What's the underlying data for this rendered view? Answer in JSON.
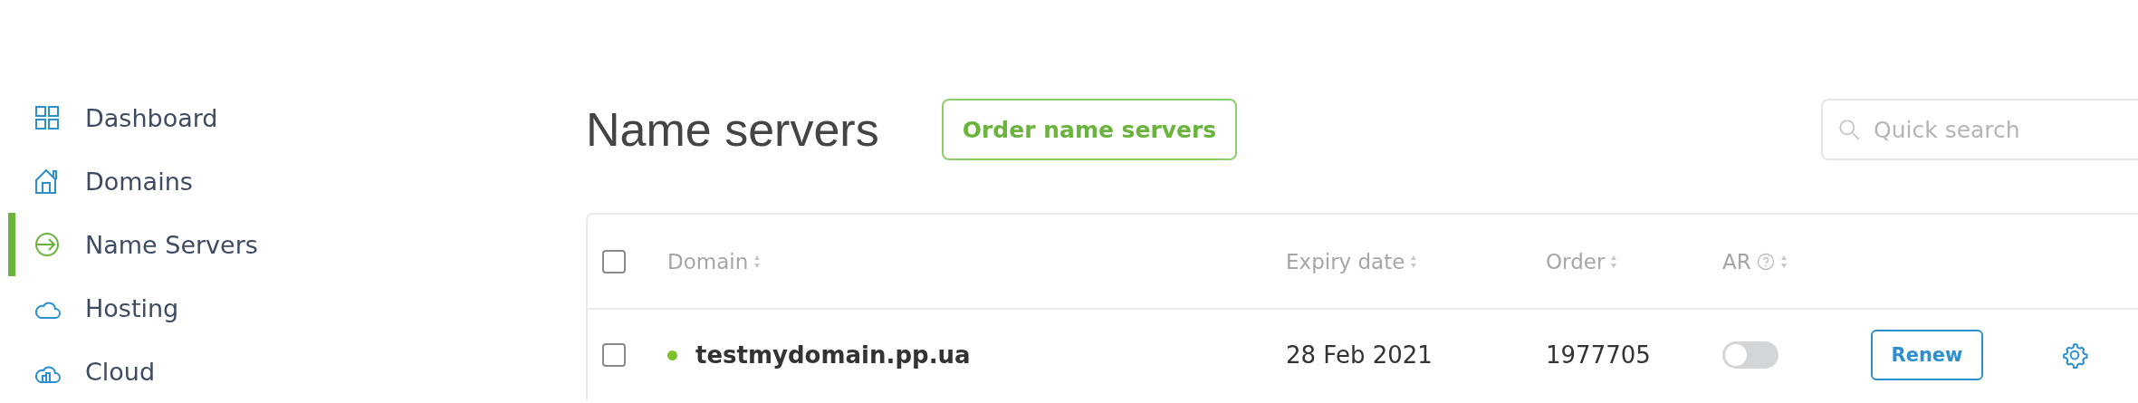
{
  "sidebar": {
    "items": [
      {
        "label": "Dashboard",
        "selected": false
      },
      {
        "label": "Domains",
        "selected": false
      },
      {
        "label": "Name Servers",
        "selected": true
      },
      {
        "label": "Hosting",
        "selected": false
      },
      {
        "label": "Cloud",
        "selected": false
      }
    ]
  },
  "page": {
    "title": "Name servers",
    "order_button": "Order name servers",
    "search": {
      "placeholder": "Quick search"
    }
  },
  "table": {
    "select_all": {
      "checked": false
    },
    "columns": [
      {
        "label": "Domain"
      },
      {
        "label": "Expiry date"
      },
      {
        "label": "Order"
      },
      {
        "label": "AR"
      }
    ],
    "rows": [
      {
        "checked": false,
        "color": "#7cc22d",
        "domain": "testmydomain.pp.ua",
        "expiry": "28 Feb 2021",
        "order": "1977705",
        "auto_renew": {
          "on": false
        },
        "action": "Renew"
      }
    ]
  }
}
